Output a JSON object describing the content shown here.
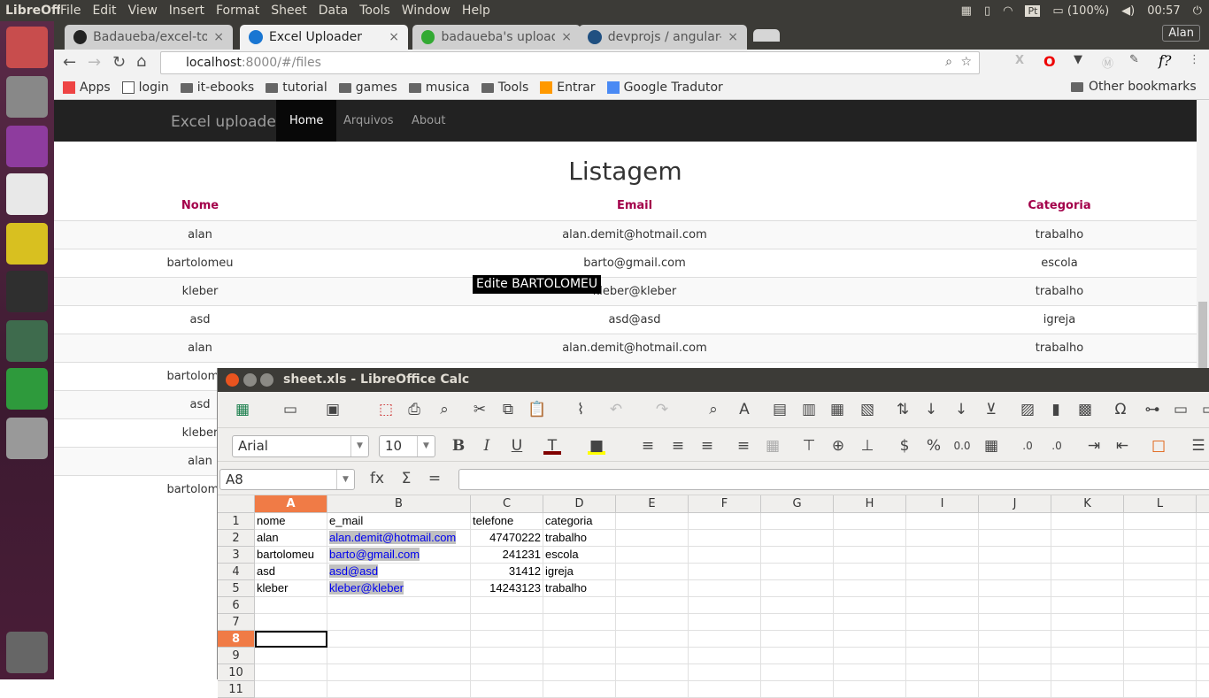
{
  "topbar": {
    "app": "LibreOffice",
    "menus": [
      "File",
      "Edit",
      "View",
      "Insert",
      "Format",
      "Sheet",
      "Data",
      "Tools",
      "Window",
      "Help"
    ],
    "lang": "Pt",
    "battery": "(100%)",
    "time": "00:57"
  },
  "launcher": {
    "items": [
      "ubuntu-dash-icon",
      "files-icon",
      "software-center-icon",
      "chrome-icon",
      "rhythmbox-icon",
      "terminal-icon",
      "atom-icon",
      "libreoffice-calc-icon",
      "disk-icon",
      "trash-icon"
    ]
  },
  "browser": {
    "tabs": [
      {
        "label": "Badaueba/excel-to-",
        "icon": "github-icon"
      },
      {
        "label": "Excel Uploader",
        "icon": "angular-icon",
        "active": true
      },
      {
        "label": "badaueba's upload",
        "icon": "green-dot-icon"
      },
      {
        "label": "devprojs / angular-",
        "icon": "bitbucket-icon"
      }
    ],
    "user": "Alan",
    "url_host": "localhost",
    "url_rest": ":8000/#/files",
    "bookmarks": [
      "Apps",
      "login",
      "it-ebooks",
      "tutorial",
      "games",
      "musica",
      "Tools",
      "Entrar",
      "Google Tradutor"
    ],
    "other_bookmarks": "Other bookmarks"
  },
  "webpage": {
    "brand": "Excel uploader",
    "nav": [
      "Home",
      "Arquivos",
      "About"
    ],
    "title": "Listagem",
    "headers": [
      "Nome",
      "Email",
      "Categoria"
    ],
    "rows": [
      [
        "alan",
        "alan.demit@hotmail.com",
        "trabalho"
      ],
      [
        "bartolomeu",
        "barto@gmail.com",
        "escola"
      ],
      [
        "kleber",
        "kleber@kleber",
        "trabalho"
      ],
      [
        "asd",
        "asd@asd",
        "igreja"
      ],
      [
        "alan",
        "alan.demit@hotmail.com",
        "trabalho"
      ],
      [
        "bartolomeu",
        "",
        "",
        ""
      ],
      [
        "asd",
        "",
        ""
      ],
      [
        "kleber",
        "",
        ""
      ],
      [
        "alan",
        "",
        ""
      ],
      [
        "bartolomeu",
        "",
        ""
      ]
    ],
    "tooltip": "Edite BARTOLOMEU"
  },
  "calc": {
    "title": "sheet.xls - LibreOffice Calc",
    "font": "Arial",
    "size": "10",
    "namebox": "A8",
    "formula": "",
    "columns": [
      "A",
      "B",
      "C",
      "D",
      "E",
      "F",
      "G",
      "H",
      "I",
      "J",
      "K",
      "L"
    ],
    "rownums": [
      "1",
      "2",
      "3",
      "4",
      "5",
      "6",
      "7",
      "8",
      "9",
      "10",
      "11"
    ],
    "cells": [
      [
        "nome",
        "e_mail",
        "telefone",
        "categoria"
      ],
      [
        "alan",
        "alan.demit@hotmail.com",
        "47470222",
        "trabalho"
      ],
      [
        "bartolomeu",
        "barto@gmail.com",
        "241231",
        "escola"
      ],
      [
        "asd",
        "asd@asd",
        "31412",
        "igreja"
      ],
      [
        "kleber",
        "kleber@kleber",
        "14243123",
        "trabalho"
      ]
    ],
    "font_color": "#800000",
    "highlight_color": "#ffff00",
    "accent": "#f07b46"
  }
}
